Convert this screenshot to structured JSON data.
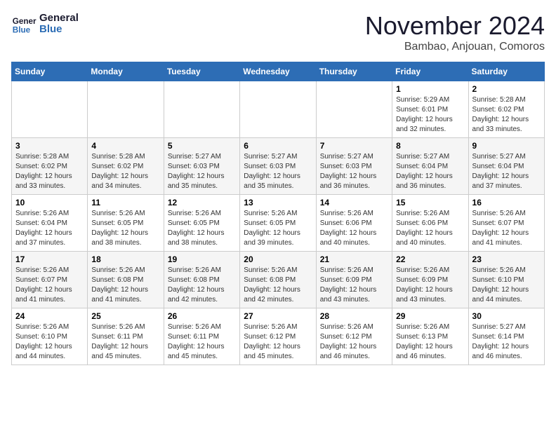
{
  "header": {
    "logo_line1": "General",
    "logo_line2": "Blue",
    "month": "November 2024",
    "location": "Bambao, Anjouan, Comoros"
  },
  "weekdays": [
    "Sunday",
    "Monday",
    "Tuesday",
    "Wednesday",
    "Thursday",
    "Friday",
    "Saturday"
  ],
  "weeks": [
    [
      {
        "day": "",
        "info": ""
      },
      {
        "day": "",
        "info": ""
      },
      {
        "day": "",
        "info": ""
      },
      {
        "day": "",
        "info": ""
      },
      {
        "day": "",
        "info": ""
      },
      {
        "day": "1",
        "info": "Sunrise: 5:29 AM\nSunset: 6:01 PM\nDaylight: 12 hours\nand 32 minutes."
      },
      {
        "day": "2",
        "info": "Sunrise: 5:28 AM\nSunset: 6:02 PM\nDaylight: 12 hours\nand 33 minutes."
      }
    ],
    [
      {
        "day": "3",
        "info": "Sunrise: 5:28 AM\nSunset: 6:02 PM\nDaylight: 12 hours\nand 33 minutes."
      },
      {
        "day": "4",
        "info": "Sunrise: 5:28 AM\nSunset: 6:02 PM\nDaylight: 12 hours\nand 34 minutes."
      },
      {
        "day": "5",
        "info": "Sunrise: 5:27 AM\nSunset: 6:03 PM\nDaylight: 12 hours\nand 35 minutes."
      },
      {
        "day": "6",
        "info": "Sunrise: 5:27 AM\nSunset: 6:03 PM\nDaylight: 12 hours\nand 35 minutes."
      },
      {
        "day": "7",
        "info": "Sunrise: 5:27 AM\nSunset: 6:03 PM\nDaylight: 12 hours\nand 36 minutes."
      },
      {
        "day": "8",
        "info": "Sunrise: 5:27 AM\nSunset: 6:04 PM\nDaylight: 12 hours\nand 36 minutes."
      },
      {
        "day": "9",
        "info": "Sunrise: 5:27 AM\nSunset: 6:04 PM\nDaylight: 12 hours\nand 37 minutes."
      }
    ],
    [
      {
        "day": "10",
        "info": "Sunrise: 5:26 AM\nSunset: 6:04 PM\nDaylight: 12 hours\nand 37 minutes."
      },
      {
        "day": "11",
        "info": "Sunrise: 5:26 AM\nSunset: 6:05 PM\nDaylight: 12 hours\nand 38 minutes."
      },
      {
        "day": "12",
        "info": "Sunrise: 5:26 AM\nSunset: 6:05 PM\nDaylight: 12 hours\nand 38 minutes."
      },
      {
        "day": "13",
        "info": "Sunrise: 5:26 AM\nSunset: 6:05 PM\nDaylight: 12 hours\nand 39 minutes."
      },
      {
        "day": "14",
        "info": "Sunrise: 5:26 AM\nSunset: 6:06 PM\nDaylight: 12 hours\nand 40 minutes."
      },
      {
        "day": "15",
        "info": "Sunrise: 5:26 AM\nSunset: 6:06 PM\nDaylight: 12 hours\nand 40 minutes."
      },
      {
        "day": "16",
        "info": "Sunrise: 5:26 AM\nSunset: 6:07 PM\nDaylight: 12 hours\nand 41 minutes."
      }
    ],
    [
      {
        "day": "17",
        "info": "Sunrise: 5:26 AM\nSunset: 6:07 PM\nDaylight: 12 hours\nand 41 minutes."
      },
      {
        "day": "18",
        "info": "Sunrise: 5:26 AM\nSunset: 6:08 PM\nDaylight: 12 hours\nand 41 minutes."
      },
      {
        "day": "19",
        "info": "Sunrise: 5:26 AM\nSunset: 6:08 PM\nDaylight: 12 hours\nand 42 minutes."
      },
      {
        "day": "20",
        "info": "Sunrise: 5:26 AM\nSunset: 6:08 PM\nDaylight: 12 hours\nand 42 minutes."
      },
      {
        "day": "21",
        "info": "Sunrise: 5:26 AM\nSunset: 6:09 PM\nDaylight: 12 hours\nand 43 minutes."
      },
      {
        "day": "22",
        "info": "Sunrise: 5:26 AM\nSunset: 6:09 PM\nDaylight: 12 hours\nand 43 minutes."
      },
      {
        "day": "23",
        "info": "Sunrise: 5:26 AM\nSunset: 6:10 PM\nDaylight: 12 hours\nand 44 minutes."
      }
    ],
    [
      {
        "day": "24",
        "info": "Sunrise: 5:26 AM\nSunset: 6:10 PM\nDaylight: 12 hours\nand 44 minutes."
      },
      {
        "day": "25",
        "info": "Sunrise: 5:26 AM\nSunset: 6:11 PM\nDaylight: 12 hours\nand 45 minutes."
      },
      {
        "day": "26",
        "info": "Sunrise: 5:26 AM\nSunset: 6:11 PM\nDaylight: 12 hours\nand 45 minutes."
      },
      {
        "day": "27",
        "info": "Sunrise: 5:26 AM\nSunset: 6:12 PM\nDaylight: 12 hours\nand 45 minutes."
      },
      {
        "day": "28",
        "info": "Sunrise: 5:26 AM\nSunset: 6:12 PM\nDaylight: 12 hours\nand 46 minutes."
      },
      {
        "day": "29",
        "info": "Sunrise: 5:26 AM\nSunset: 6:13 PM\nDaylight: 12 hours\nand 46 minutes."
      },
      {
        "day": "30",
        "info": "Sunrise: 5:27 AM\nSunset: 6:14 PM\nDaylight: 12 hours\nand 46 minutes."
      }
    ]
  ]
}
